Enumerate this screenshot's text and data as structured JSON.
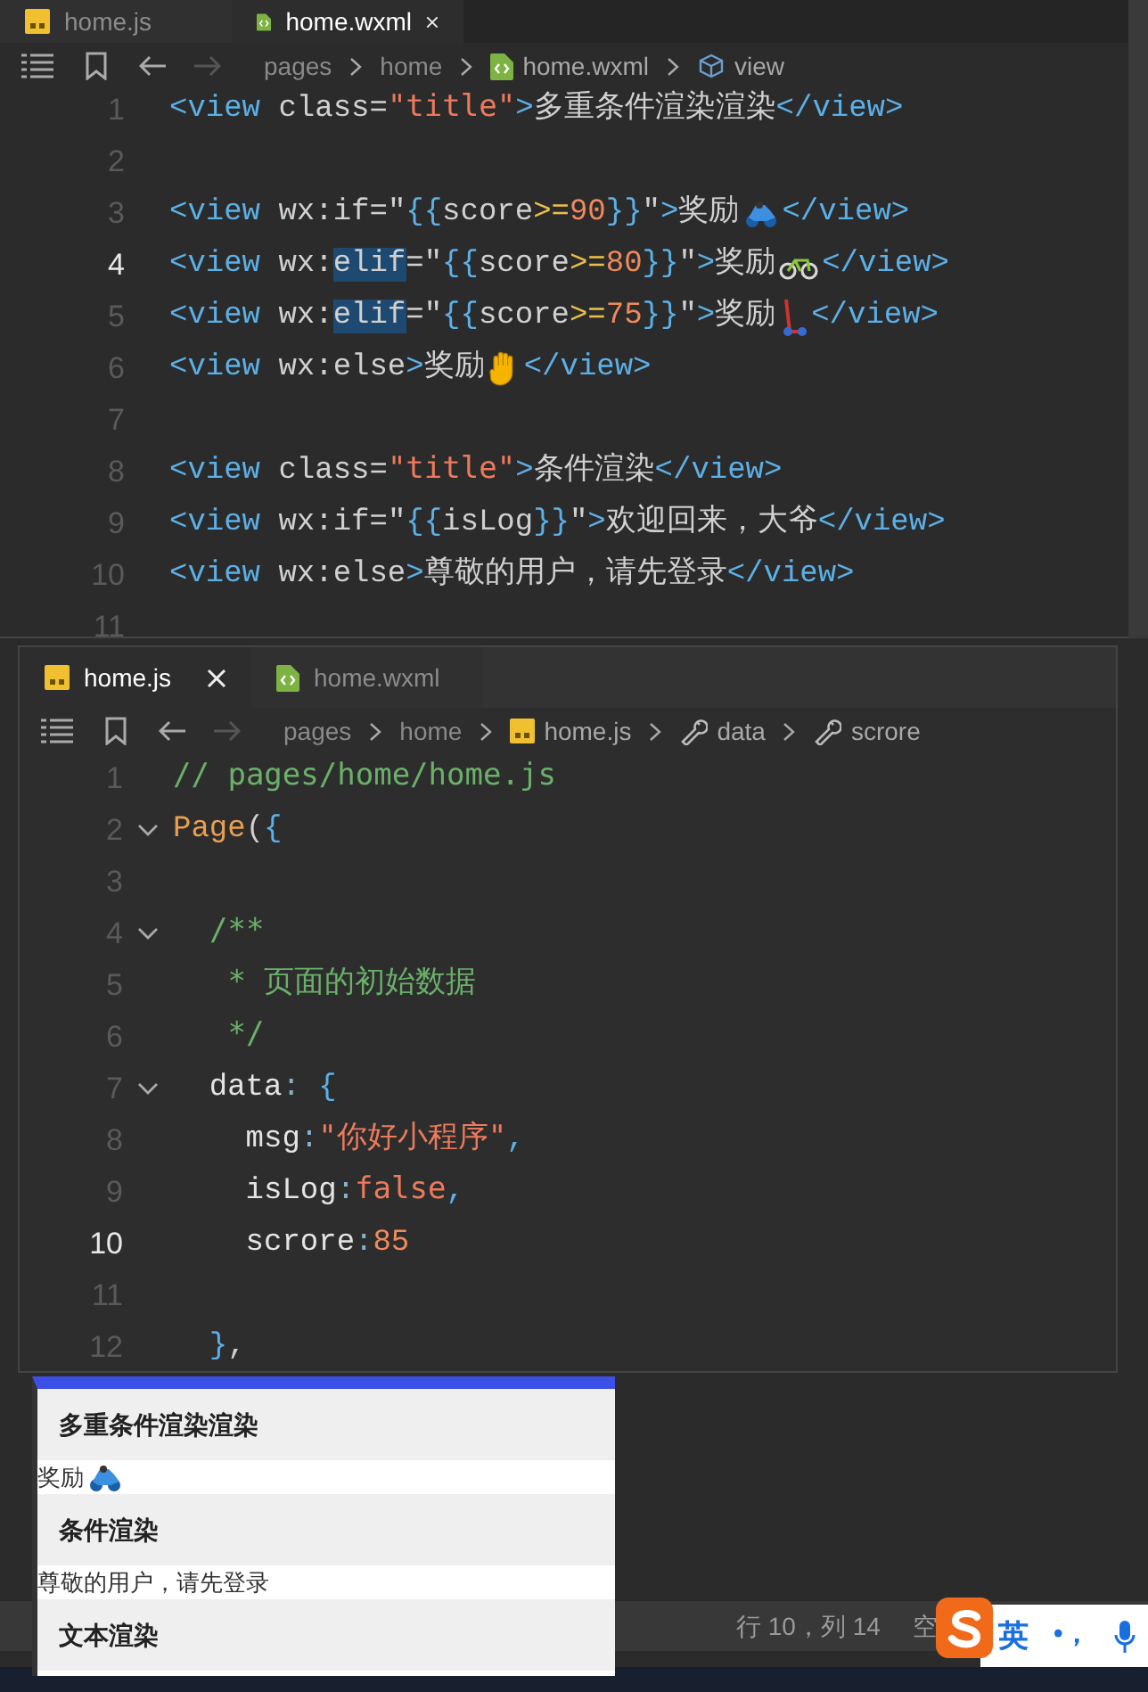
{
  "top_editor": {
    "tabs": [
      {
        "label": "home.js",
        "kind": "js",
        "selected": false,
        "closable": false
      },
      {
        "label": "home.wxml",
        "kind": "wxml",
        "selected": true,
        "closable": true
      }
    ],
    "breadcrumb": [
      {
        "label": "pages",
        "kind": "folder"
      },
      {
        "label": "home",
        "kind": "folder"
      },
      {
        "label": "home.wxml",
        "kind": "wxml"
      },
      {
        "label": "view",
        "kind": "cube"
      }
    ],
    "lines": [
      {
        "number": "1",
        "current": false,
        "tokens": [
          {
            "kind": "tag",
            "text": "<view "
          },
          {
            "kind": "attr",
            "text": "class="
          },
          {
            "kind": "str",
            "text": "\"title\""
          },
          {
            "kind": "tag",
            "text": ">"
          },
          {
            "kind": "text",
            "text": "多重条件渲染渲染"
          },
          {
            "kind": "tag",
            "text": "</view>"
          }
        ]
      },
      {
        "number": "2",
        "current": false
      },
      {
        "number": "3",
        "current": false,
        "tokens": [
          {
            "kind": "tag",
            "text": "<view "
          },
          {
            "kind": "attr",
            "text": "wx:if="
          },
          {
            "kind": "punct",
            "text": "\""
          },
          {
            "kind": "brace",
            "text": "{{"
          },
          {
            "kind": "attr",
            "text": "score"
          },
          {
            "kind": "op",
            "text": ">="
          },
          {
            "kind": "num",
            "text": "90"
          },
          {
            "kind": "brace",
            "text": "}}"
          },
          {
            "kind": "punct",
            "text": "\""
          },
          {
            "kind": "tag",
            "text": ">"
          },
          {
            "kind": "text",
            "text": "奖励"
          },
          {
            "kind": "emoji"
          },
          {
            "kind": "tag",
            "text": "</view>"
          }
        ]
      },
      {
        "number": "4",
        "current": true,
        "tokens": [
          {
            "kind": "tag",
            "text": "<view "
          },
          {
            "kind": "attr",
            "text": "wx:"
          },
          {
            "kind": "hl",
            "text": "elif"
          },
          {
            "kind": "attr",
            "text": "="
          },
          {
            "kind": "punct",
            "text": "\""
          },
          {
            "kind": "brace",
            "text": "{{"
          },
          {
            "kind": "attr",
            "text": "score"
          },
          {
            "kind": "op",
            "text": ">="
          },
          {
            "kind": "num",
            "text": "80"
          },
          {
            "kind": "brace",
            "text": "}}"
          },
          {
            "kind": "punct",
            "text": "\""
          },
          {
            "kind": "tag",
            "text": ">"
          },
          {
            "kind": "text",
            "text": "奖励"
          },
          {
            "kind": "emoji"
          },
          {
            "kind": "tag",
            "text": "</view>"
          }
        ]
      },
      {
        "number": "5",
        "current": false,
        "tokens": [
          {
            "kind": "tag",
            "text": "<view "
          },
          {
            "kind": "attr",
            "text": "wx:"
          },
          {
            "kind": "hl",
            "text": "elif"
          },
          {
            "kind": "attr",
            "text": "="
          },
          {
            "kind": "punct",
            "text": "\""
          },
          {
            "kind": "brace",
            "text": "{{"
          },
          {
            "kind": "attr",
            "text": "score"
          },
          {
            "kind": "op",
            "text": ">="
          },
          {
            "kind": "num",
            "text": "75"
          },
          {
            "kind": "brace",
            "text": "}}"
          },
          {
            "kind": "punct",
            "text": "\""
          },
          {
            "kind": "tag",
            "text": ">"
          },
          {
            "kind": "text",
            "text": "奖励"
          },
          {
            "kind": "emoji"
          },
          {
            "kind": "tag",
            "text": "</view>"
          }
        ]
      },
      {
        "number": "6",
        "current": false,
        "tokens": [
          {
            "kind": "tag",
            "text": "<view "
          },
          {
            "kind": "attr",
            "text": "wx:else"
          },
          {
            "kind": "tag",
            "text": ">"
          },
          {
            "kind": "text",
            "text": "奖励"
          },
          {
            "kind": "emoji"
          },
          {
            "kind": "tag",
            "text": "</view>"
          }
        ]
      },
      {
        "number": "7",
        "current": false
      },
      {
        "number": "8",
        "current": false,
        "tokens": [
          {
            "kind": "tag",
            "text": "<view "
          },
          {
            "kind": "attr",
            "text": "class="
          },
          {
            "kind": "str",
            "text": "\"title\""
          },
          {
            "kind": "tag",
            "text": ">"
          },
          {
            "kind": "text",
            "text": "条件渲染"
          },
          {
            "kind": "tag",
            "text": "</view>"
          }
        ]
      },
      {
        "number": "9",
        "current": false,
        "tokens": [
          {
            "kind": "tag",
            "text": "<view "
          },
          {
            "kind": "attr",
            "text": "wx:if="
          },
          {
            "kind": "punct",
            "text": "\""
          },
          {
            "kind": "brace",
            "text": "{{"
          },
          {
            "kind": "attr",
            "text": "isLog"
          },
          {
            "kind": "brace",
            "text": "}}"
          },
          {
            "kind": "punct",
            "text": "\""
          },
          {
            "kind": "tag",
            "text": ">"
          },
          {
            "kind": "text",
            "text": "欢迎回来，大爷"
          },
          {
            "kind": "tag",
            "text": "</view>"
          }
        ]
      },
      {
        "number": "10",
        "current": false,
        "tokens": [
          {
            "kind": "tag",
            "text": "<view "
          },
          {
            "kind": "attr",
            "text": "wx:else"
          },
          {
            "kind": "tag",
            "text": ">"
          },
          {
            "kind": "text",
            "text": "尊敬的用户，请先登录"
          },
          {
            "kind": "tag",
            "text": "</view>"
          }
        ]
      },
      {
        "number": "11",
        "current": false
      }
    ]
  },
  "bottom_editor": {
    "tabs": [
      {
        "label": "home.js",
        "kind": "js",
        "selected": true,
        "closable": true
      },
      {
        "label": "home.wxml",
        "kind": "wxml",
        "selected": false,
        "closable": false
      }
    ],
    "breadcrumb": [
      {
        "label": "pages",
        "kind": "folder"
      },
      {
        "label": "home",
        "kind": "folder"
      },
      {
        "label": "home.js",
        "kind": "js"
      },
      {
        "label": "data",
        "kind": "wrench"
      },
      {
        "label": "scrore",
        "kind": "wrench"
      }
    ],
    "lines": [
      {
        "number": "1",
        "current": false,
        "fold": false,
        "tokens": [
          {
            "kind": "comment",
            "text": "// pages/home/home.js"
          }
        ]
      },
      {
        "number": "2",
        "current": false,
        "fold": true,
        "tokens": [
          {
            "kind": "fn",
            "text": "Page"
          },
          {
            "kind": "punct",
            "text": "("
          },
          {
            "kind": "brace",
            "text": "{"
          }
        ]
      },
      {
        "number": "3",
        "current": false,
        "fold": false
      },
      {
        "number": "4",
        "current": false,
        "fold": true,
        "tokens": [
          {
            "kind": "comment",
            "text": "  /**"
          }
        ]
      },
      {
        "number": "5",
        "current": false,
        "fold": false,
        "tokens": [
          {
            "kind": "comment",
            "text": "   * 页面的初始数据"
          }
        ]
      },
      {
        "number": "6",
        "current": false,
        "fold": false,
        "tokens": [
          {
            "kind": "comment",
            "text": "   */"
          }
        ]
      },
      {
        "number": "7",
        "current": false,
        "fold": true,
        "tokens": [
          {
            "kind": "key",
            "text": "  data"
          },
          {
            "kind": "colon",
            "text": ": "
          },
          {
            "kind": "brace",
            "text": "{"
          }
        ]
      },
      {
        "number": "8",
        "current": false,
        "fold": false,
        "tokens": [
          {
            "kind": "key",
            "text": "    msg"
          },
          {
            "kind": "colon",
            "text": ":"
          },
          {
            "kind": "str",
            "text": "\"你好小程序\""
          },
          {
            "kind": "brace",
            "text": ","
          }
        ]
      },
      {
        "number": "9",
        "current": false,
        "fold": false,
        "tokens": [
          {
            "kind": "key",
            "text": "    isLog"
          },
          {
            "kind": "colon",
            "text": ":"
          },
          {
            "kind": "str",
            "text": "false"
          },
          {
            "kind": "brace",
            "text": ","
          }
        ]
      },
      {
        "number": "10",
        "current": true,
        "fold": false,
        "tokens": [
          {
            "kind": "key",
            "text": "    scrore"
          },
          {
            "kind": "colon",
            "text": ":"
          },
          {
            "kind": "num",
            "text": "85"
          }
        ]
      },
      {
        "number": "11",
        "current": false,
        "fold": false
      },
      {
        "number": "12",
        "current": false,
        "fold": false,
        "tokens": [
          {
            "kind": "brace",
            "text": "  }"
          },
          {
            "kind": "punct",
            "text": ","
          }
        ]
      }
    ]
  },
  "preview": {
    "items": [
      {
        "kind": "title",
        "text": "多重条件渲染渲染"
      },
      {
        "kind": "row",
        "text": "奖励",
        "emoji": true
      },
      {
        "kind": "title",
        "text": "条件渲染"
      },
      {
        "kind": "row",
        "text": "尊敬的用户，请先登录",
        "emoji": false
      },
      {
        "kind": "title",
        "text": "文本渲染"
      }
    ]
  },
  "status_bar": {
    "position": "行 10，列 14",
    "indent": "空"
  },
  "ime": {
    "language": "英",
    "punctuation": "•，"
  }
}
